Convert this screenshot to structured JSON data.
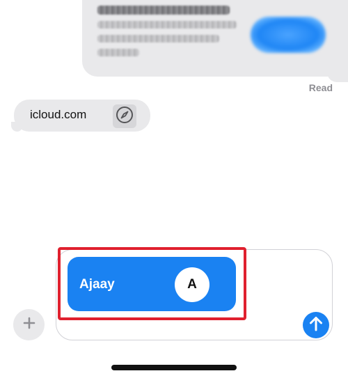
{
  "conversation": {
    "top_message": {
      "content": "blurred-redacted",
      "action_button_color": "#1a82f2"
    },
    "read_receipt": "Read",
    "link_message": {
      "text": "icloud.com",
      "icon": "compass-icon"
    }
  },
  "compose": {
    "add_button_icon": "plus-icon",
    "contact_card": {
      "name": "Ajaay",
      "initial": "A",
      "color": "#1a82f2"
    },
    "highlight_color": "#e0202e",
    "send_button_icon": "arrow-up-icon"
  },
  "colors": {
    "bubble_gray": "#e9e9eb",
    "accent_blue": "#1a82f2",
    "secondary_text": "#8e8e93"
  }
}
